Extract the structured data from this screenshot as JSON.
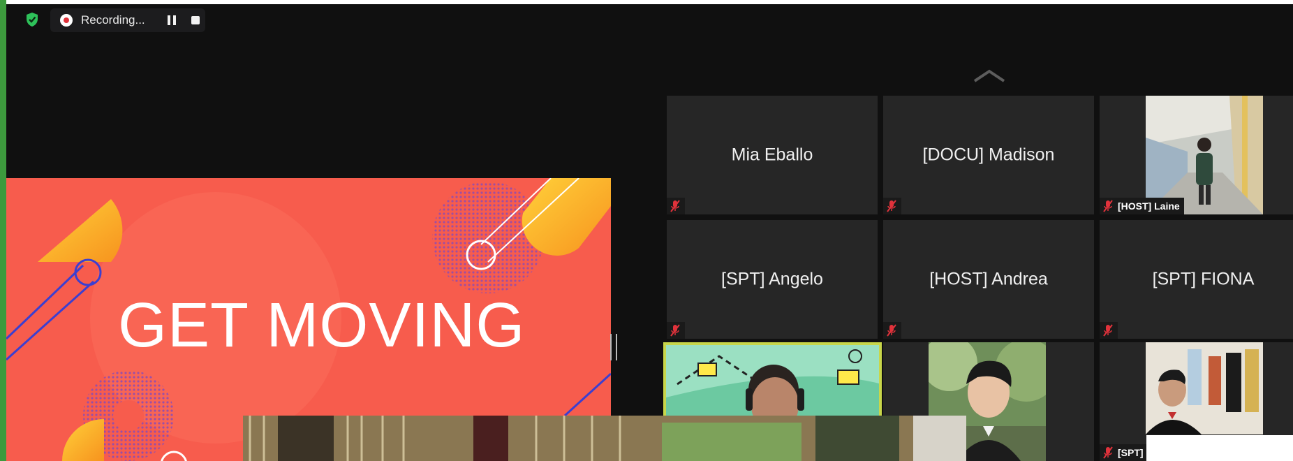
{
  "recording": {
    "status_text": "Recording...",
    "security_icon": "shield-check-icon",
    "record_icon": "record-dot-icon",
    "pause_icon": "pause-icon",
    "stop_icon": "stop-icon"
  },
  "slide": {
    "title": "GET MOVING",
    "background_color": "#f75c4d"
  },
  "gallery": {
    "scroll_up_icon": "chevron-up-icon",
    "participants": [
      {
        "name": "Mia Eballo",
        "muted": true,
        "video": false
      },
      {
        "name": "[DOCU] Madison",
        "muted": true,
        "video": false
      },
      {
        "name": "[HOST] Laine",
        "muted": true,
        "video": true
      },
      {
        "name": "[SPT] Angelo",
        "muted": true,
        "video": false
      },
      {
        "name": "[HOST] Andrea",
        "muted": true,
        "video": false
      },
      {
        "name": "[SPT] FIONA",
        "muted": true,
        "video": false
      },
      {
        "name": "",
        "muted": false,
        "video": true,
        "speaking": true
      },
      {
        "name": "",
        "muted": false,
        "video": true
      },
      {
        "name": "[SPT]",
        "muted": true,
        "video": true
      }
    ]
  },
  "colors": {
    "accent_green": "#3d9a3d",
    "record_red": "#e0323b",
    "active_speaker": "#c8d64a",
    "tile_bg": "#262626"
  }
}
